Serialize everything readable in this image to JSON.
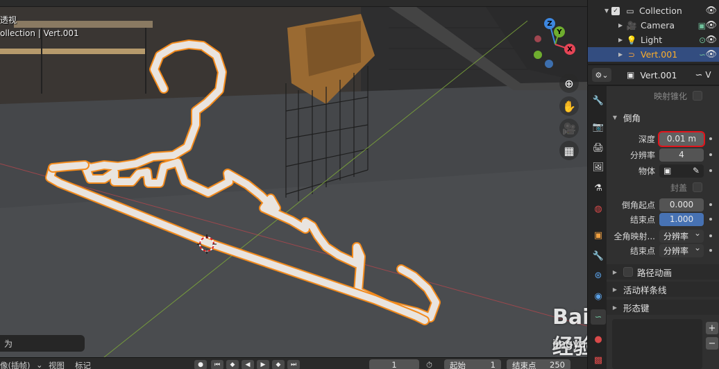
{
  "viewport": {
    "header_label": "透视",
    "collection_label": "ollection | Vert.001",
    "bottom_label": "为",
    "nav_icons": [
      "zoom-icon",
      "hand-pan-icon",
      "camera-view-icon",
      "grid-ortho-icon"
    ],
    "gizmo_axes": [
      "Z",
      "Y",
      "X"
    ]
  },
  "outliner": {
    "items": [
      {
        "label": "Collection",
        "icon": "collection-icon"
      },
      {
        "label": "Camera",
        "icon": "camera-icon"
      },
      {
        "label": "Light",
        "icon": "light-icon"
      },
      {
        "label": "Vert.001",
        "icon": "curve-icon",
        "selected": true
      }
    ]
  },
  "properties": {
    "object_name": "Vert.001",
    "header_right": "V",
    "map_taper_label": "映射锥化",
    "bevel_section": "倒角",
    "depth_label": "深度",
    "depth_value": "0.01 m",
    "resolution_label": "分辨率",
    "resolution_value": "4",
    "object_label": "物体",
    "fill_caps_label": "封盖",
    "bevel_start_label": "倒角起点",
    "bevel_start_value": "0.000",
    "end_label": "结束点",
    "end_value": "1.000",
    "full_map_label": "全角映射...",
    "full_map_value": "分辨率",
    "end2_label": "结束点",
    "end2_value": "分辨率",
    "path_anim_label": "路径动画",
    "active_spline_label": "活动样条线",
    "shape_keys_label": "形态键"
  },
  "timeline": {
    "mode_label": "像(插帧)",
    "view_label": "视图",
    "marker_label": "标记",
    "current_frame": "1",
    "start_label": "起始",
    "start_value": "1",
    "end_label": "结束点",
    "end_value": "250"
  },
  "watermark": {
    "brand": "Baidu经验",
    "url": "jingyan.baidu.com"
  },
  "colors": {
    "selection_orange": "#ff8c1a",
    "active_blue": "#4772b3",
    "highlight_red": "#e3141b",
    "axis_x": "#e64556",
    "axis_y": "#6fad2f",
    "axis_z": "#3d87e0"
  }
}
